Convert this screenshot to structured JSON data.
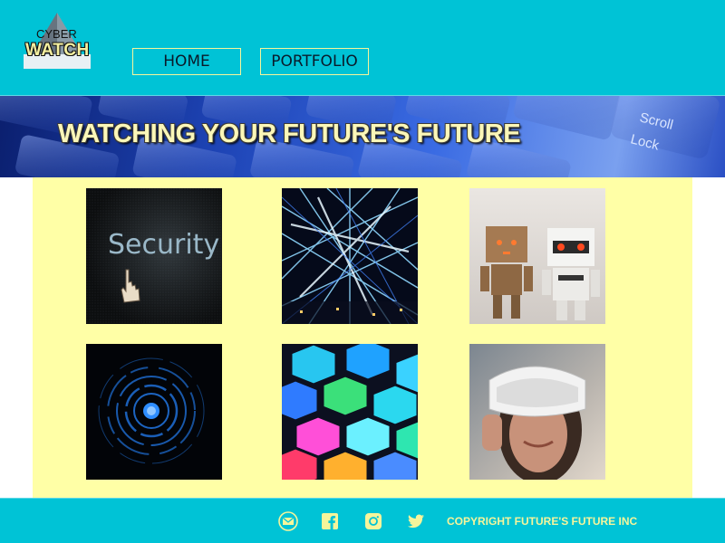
{
  "logo": {
    "line1": "CYBER",
    "line2": "WATCH"
  },
  "nav": {
    "home_label": "HOME",
    "portfolio_label": "PORTFOLIO"
  },
  "banner": {
    "title": "WATCHING YOUR FUTURE'S FUTURE",
    "key_texts": [
      "Scroll",
      "Lock"
    ]
  },
  "gallery": {
    "tiles": [
      {
        "name": "security-screen-image",
        "text": "Security"
      },
      {
        "name": "light-network-image"
      },
      {
        "name": "toy-robots-image"
      },
      {
        "name": "blue-circles-image"
      },
      {
        "name": "hexagon-lights-image"
      },
      {
        "name": "vr-headset-image"
      }
    ]
  },
  "footer": {
    "icons": [
      "email-icon",
      "facebook-icon",
      "instagram-icon",
      "twitter-icon"
    ],
    "copyright": "COPYRIGHT FUTURE'S FUTURE INC"
  },
  "colors": {
    "header_bg": "#00c3d6",
    "content_bg": "#ffffa6",
    "accent_yellow": "#f6f59b"
  }
}
